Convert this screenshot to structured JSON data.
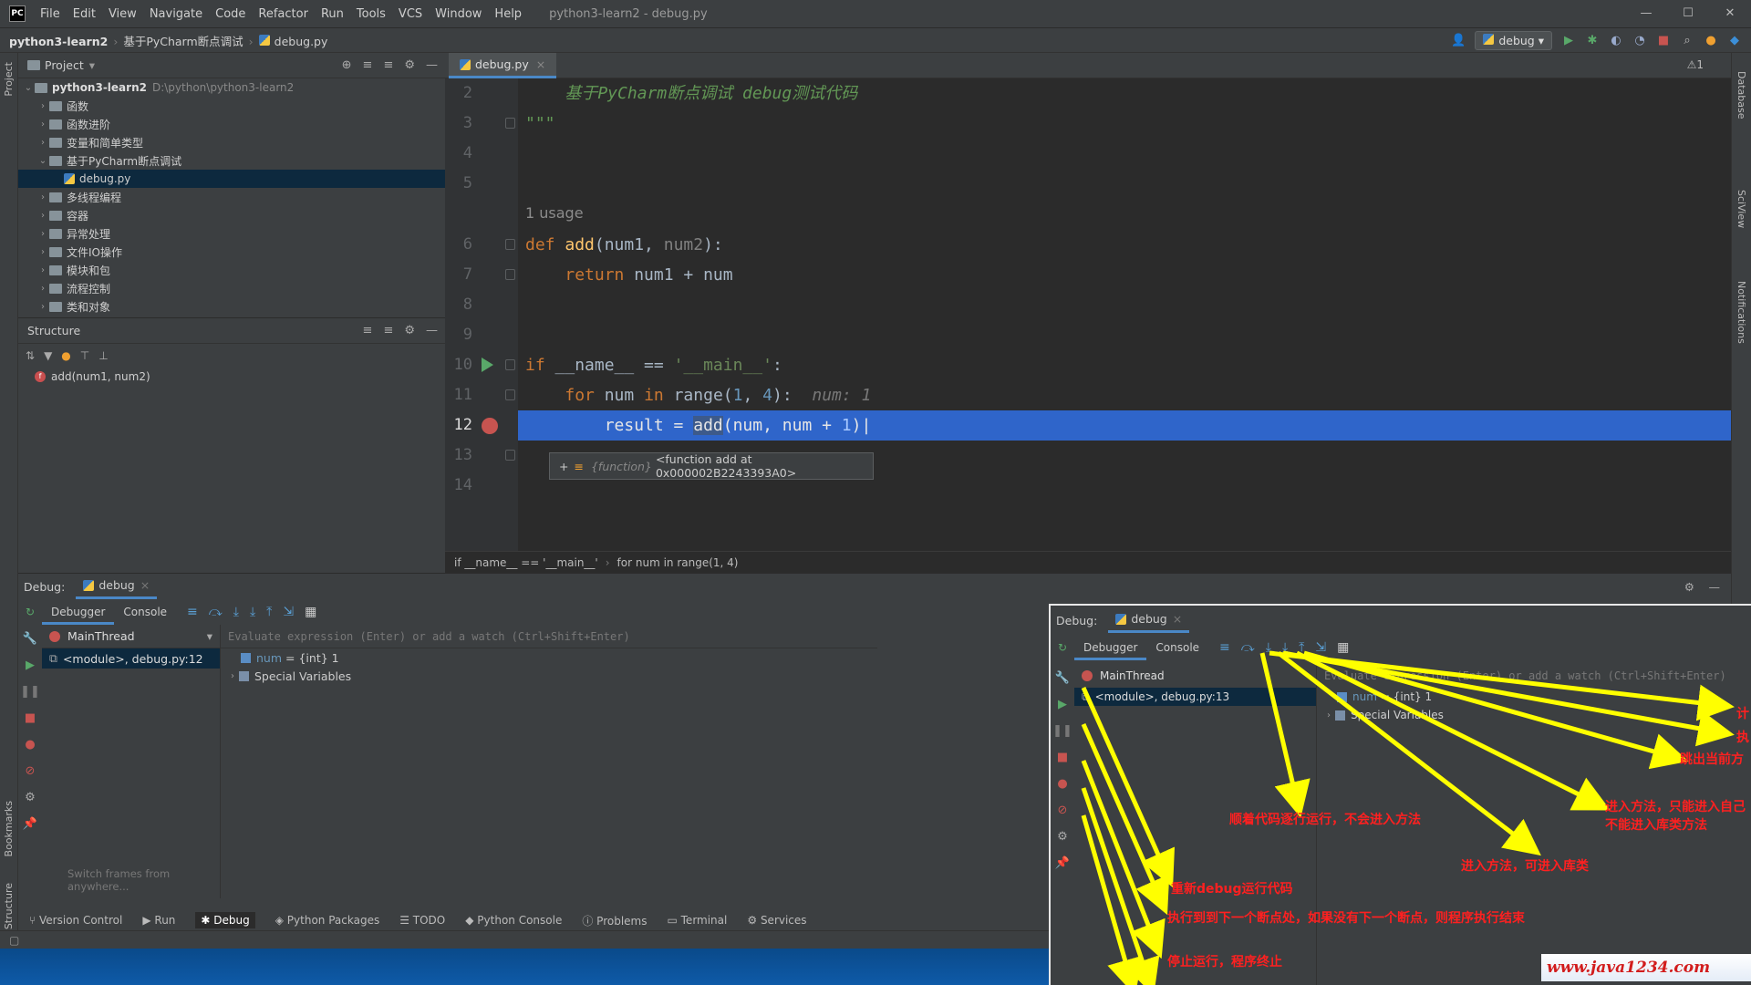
{
  "window": {
    "logo": "PC",
    "title": "python3-learn2 - debug.py",
    "menu": [
      "File",
      "Edit",
      "View",
      "Navigate",
      "Code",
      "Refactor",
      "Run",
      "Tools",
      "VCS",
      "Window",
      "Help"
    ],
    "controls": [
      "—",
      "☐",
      "✕"
    ]
  },
  "navbar": {
    "project": "python3-learn2",
    "folder": "基于PyCharm断点调试",
    "file": "debug.py",
    "run_config": "debug"
  },
  "project_panel": {
    "title": "Project",
    "root_name": "python3-learn2",
    "root_path": "D:\\python\\python3-learn2",
    "items": [
      {
        "label": "函数",
        "type": "folder"
      },
      {
        "label": "函数进阶",
        "type": "folder"
      },
      {
        "label": "变量和简单类型",
        "type": "folder"
      },
      {
        "label": "基于PyCharm断点调试",
        "type": "folder-open"
      },
      {
        "label": "debug.py",
        "type": "file"
      },
      {
        "label": "多线程编程",
        "type": "folder"
      },
      {
        "label": "容器",
        "type": "folder"
      },
      {
        "label": "异常处理",
        "type": "folder"
      },
      {
        "label": "文件IO操作",
        "type": "folder"
      },
      {
        "label": "模块和包",
        "type": "folder"
      },
      {
        "label": "流程控制",
        "type": "folder"
      },
      {
        "label": "类和对象",
        "type": "folder"
      }
    ]
  },
  "structure_panel": {
    "title": "Structure",
    "item": "add(num1, num2)"
  },
  "editor": {
    "tab": "debug.py",
    "warning": "⚠1",
    "lines": [
      {
        "n": "2",
        "text": "    基于PyCharm断点调试 debug测试代码"
      },
      {
        "n": "3",
        "text": "\"\"\""
      },
      {
        "n": "4",
        "text": ""
      },
      {
        "n": "5",
        "text": ""
      },
      {
        "n": "6",
        "text": "def add(num1, num2):"
      },
      {
        "n": "7",
        "text": "    return num1 + num"
      },
      {
        "n": "8",
        "text": ""
      },
      {
        "n": "9",
        "text": ""
      },
      {
        "n": "10",
        "text": "if __name__ == '__main__':"
      },
      {
        "n": "11",
        "text": "    for num in range(1, 4):"
      },
      {
        "n": "12",
        "text": "        result = add(num, num + 1)"
      },
      {
        "n": "13",
        "text": ""
      },
      {
        "n": "14",
        "text": ""
      }
    ],
    "usage_hint": "1 usage",
    "inline_value": "num: 1",
    "tooltip_type": "{function}",
    "tooltip_value": "<function add at 0x000002B2243393A0>",
    "breadcrumb": [
      "if __name__ == '__main__'",
      "for num in range(1, 4)"
    ]
  },
  "debug": {
    "label": "Debug:",
    "tab": "debug",
    "subtabs": [
      "Debugger",
      "Console"
    ],
    "thread": "MainThread",
    "frame": "<module>, debug.py:12",
    "eval_placeholder": "Evaluate expression (Enter) or add a watch (Ctrl+Shift+Enter)",
    "var_num_name": "num",
    "var_num_value": "= {int} 1",
    "special": "Special Variables",
    "switch_hint": "Switch frames from anywhere..."
  },
  "overlay": {
    "label": "Debug:",
    "tab": "debug",
    "subtabs": [
      "Debugger",
      "Console"
    ],
    "thread": "MainThread",
    "frame": "<module>, debug.py:13",
    "eval_placeholder": "Evaluate expression (Enter) or add a watch (Ctrl+Shift+Enter)",
    "var_num_name": "num",
    "var_num_value": "= {int} 1",
    "special": "Special Variables",
    "annotations": {
      "step_over": "顺着代码逐行运行，不会进入方法",
      "step_into_my": "进入方法，只能进入自己",
      "step_into_my_2": "不能进入库类方法",
      "step_into": "进入方法，可进入库类",
      "step_out": "跳出当前方",
      "rerun": "重新debug运行代码",
      "resume": "执行到到下一个断点处，如果没有下一个断点，则程序执行结束",
      "stop": "停止运行，程序终止",
      "cut1": "计",
      "cut2": "执"
    },
    "watermark": "www.java1234.com",
    "colors": {
      "arrow": "#ffff00",
      "annotation": "#ff2020"
    }
  },
  "toolwindows": [
    "Version Control",
    "Run",
    "Debug",
    "Python Packages",
    "TODO",
    "Python Console",
    "Problems",
    "Terminal",
    "Services"
  ],
  "side_labels": {
    "left": [
      "Project",
      "Bookmarks",
      "Structure"
    ],
    "right": [
      "Database",
      "SciView",
      "Notifications"
    ]
  }
}
